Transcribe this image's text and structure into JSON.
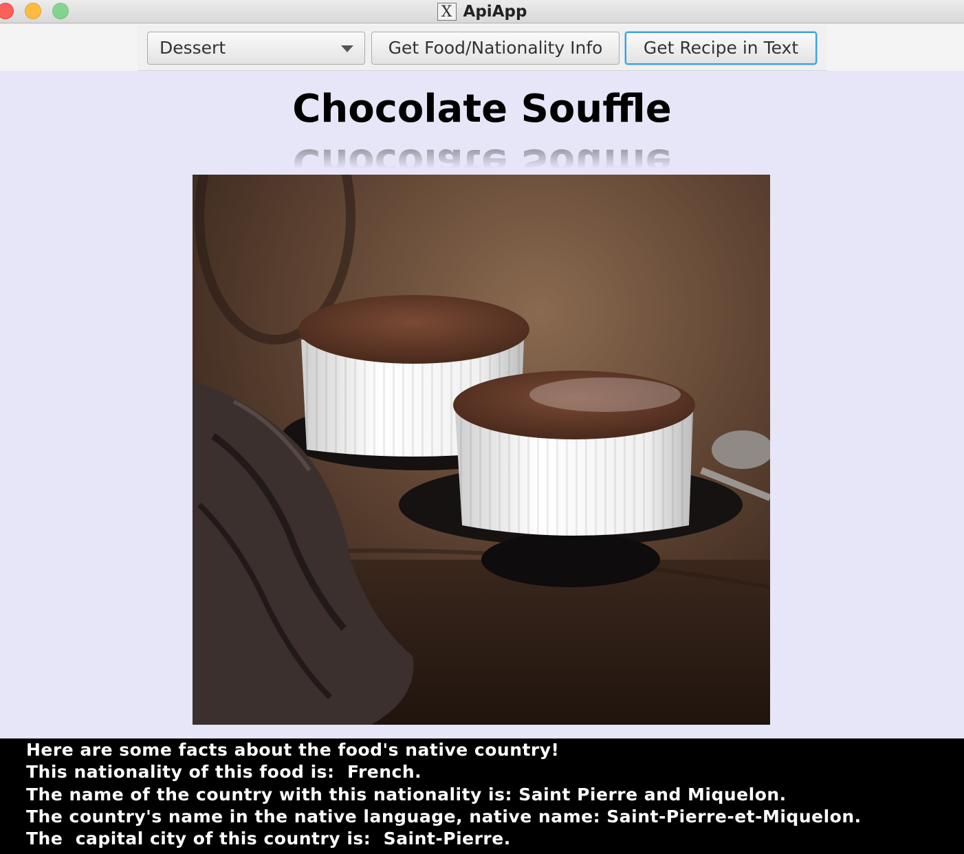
{
  "window": {
    "title": "ApiApp"
  },
  "toolbar": {
    "category_selected": "Dessert",
    "info_button": "Get Food/Nationality Info",
    "recipe_button": "Get Recipe in Text"
  },
  "food": {
    "name": "Chocolate Souffle"
  },
  "facts": [
    "Here are some facts about the food's native country!",
    "This nationality of this food is:  French.",
    "The name of the country with this nationality is: Saint Pierre and Miquelon.",
    "The country's name in the native language, native name: Saint-Pierre-et-Miquelon.",
    "The  capital city of this country is:  Saint-Pierre."
  ]
}
